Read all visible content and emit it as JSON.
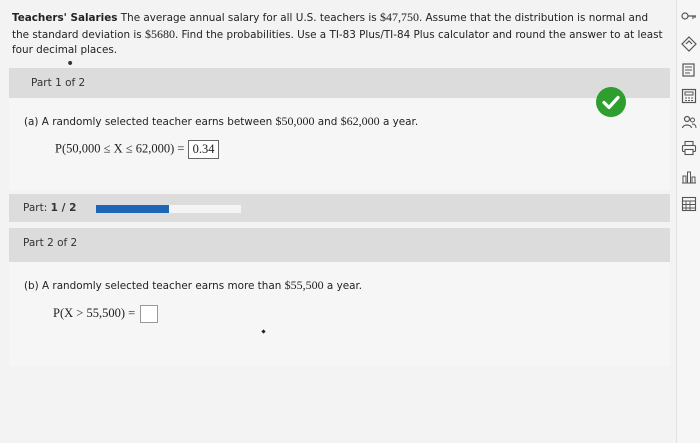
{
  "problem": {
    "title": "Teachers' Salaries",
    "text_1": " The average annual salary for all U.S. teachers is ",
    "mean": "$47,750",
    "text_2": ". Assume that the distribution is normal and the standard deviation is ",
    "sd": "$5680",
    "text_3": ". Find the probabilities. Use a TI-83 Plus/TI-84 Plus calculator and round the answer to at least four decimal places."
  },
  "part1": {
    "header": "Part 1 of 2",
    "question_a": "(a) A randomly selected teacher earns between ",
    "question_low": "$50,000",
    "question_and": " and ",
    "question_high": "$62,000",
    "question_end": " a year.",
    "expression": "P(50,000 ≤ X ≤ 62,000) = ",
    "answer": "0.34",
    "status": "correct"
  },
  "progress": {
    "label": "Part:",
    "value": "1 / 2",
    "fraction": 0.5
  },
  "part2": {
    "header": "Part 2 of 2",
    "question_a": "(b) A randomly selected teacher earns more than ",
    "question_amt": "$55,500",
    "question_end": " a year.",
    "expression": "P(X > 55,500) = ",
    "answer": ""
  },
  "colors": {
    "accent_blue": "#1d66b8",
    "check_green": "#2e9e2f"
  },
  "sidebar_icons": [
    "key-icon",
    "eraser-icon",
    "book-icon",
    "calculator-icon",
    "people-icon",
    "print-icon",
    "chart-icon",
    "table-icon"
  ]
}
